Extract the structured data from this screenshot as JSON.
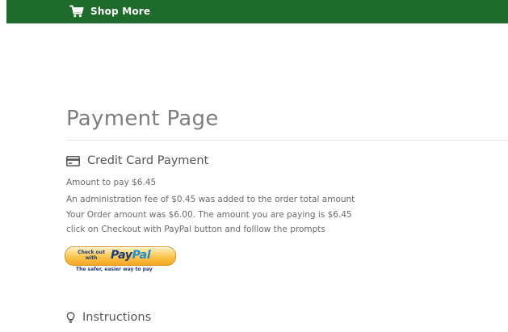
{
  "nav": {
    "shop_more_label": "Shop More",
    "bar_color": "#1f6b2c",
    "cart_icon": "cart-icon"
  },
  "page": {
    "title": "Payment Page"
  },
  "credit_card": {
    "heading": "Credit Card Payment",
    "icon": "credit-card-icon",
    "amount_line": "Amount to pay $6.45",
    "fee_line": "An administration fee of $0.45 was added to the order total amount",
    "order_line": "Your Order amount was $6.00. The amount you are paying is $6.45",
    "prompt_line": "click on Checkout with PayPal button and folllow the prompts"
  },
  "paypal_button": {
    "checkout_text": "Check out with",
    "logo_pay": "Pay",
    "logo_pal": "Pal",
    "tagline": "The safer, easier way to pay"
  },
  "instructions": {
    "heading": "Instructions",
    "icon": "lightbulb-icon"
  }
}
